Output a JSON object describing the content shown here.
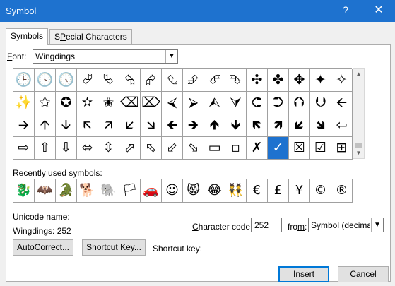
{
  "window": {
    "title": "Symbol",
    "help": "?",
    "close": "✕"
  },
  "tabs": [
    {
      "label_mn": "S",
      "label_rest": "ymbols",
      "active": true
    },
    {
      "label_pre": "",
      "label_mn": "P",
      "label_rest": "ecial Characters",
      "label_s": "S"
    }
  ],
  "font": {
    "label_mn": "F",
    "label_rest": "ont:",
    "value": "Wingdings"
  },
  "symbol_grid": [
    "🕒",
    "🕓",
    "🕔",
    "⮰",
    "⮱",
    "⮲",
    "⮳",
    "⮴",
    "⮵",
    "⮶",
    "⮷",
    "✣",
    "✤",
    "✥",
    "✦",
    "✧",
    "✨",
    "✩",
    "✪",
    "✫",
    "✬",
    "⌫",
    "⌦",
    "⮘",
    "⮚",
    "⮙",
    "⮛",
    "⮈",
    "⮊",
    "⮉",
    "⮋",
    "🡨",
    "🡪",
    "🡩",
    "🡫",
    "🡬",
    "🡭",
    "🡯",
    "🡮",
    "🡸",
    "🡺",
    "🡹",
    "🡻",
    "🡼",
    "🡽",
    "🡿",
    "🡾",
    "⇦",
    "⇨",
    "⇧",
    "⇩",
    "⬄",
    "⇳",
    "⬀",
    "⬁",
    "⬃",
    "⬂",
    "▭",
    "▫",
    "✗",
    "✓",
    "☒",
    "☑",
    "⊞"
  ],
  "selected_index": 60,
  "recent_label": "Recently used symbols:",
  "recent": [
    "🐉",
    "🦇",
    "🐊",
    "🐕",
    "🐘",
    "🏳",
    "🚗",
    "☺",
    "😸",
    "😂",
    "👯",
    "€",
    "£",
    "¥",
    "©",
    "®"
  ],
  "unicode_name_label": "Unicode name:",
  "unicode_value": "Wingdings: 252",
  "char_code": {
    "label_pre": "",
    "label_mn": "C",
    "label_rest": "haracter code:",
    "value": "252"
  },
  "from": {
    "label_pre": "fro",
    "label_mn": "m",
    "label_rest": ":",
    "value": "Symbol (decimal)"
  },
  "buttons": {
    "autocorrect": {
      "pre": "",
      "mn": "A",
      "rest": "utoCorrect..."
    },
    "shortcut_key": {
      "pre": "Shortcut ",
      "mn": "K",
      "rest": "ey..."
    },
    "insert": {
      "pre": "",
      "mn": "I",
      "rest": "nsert"
    },
    "cancel": "Cancel"
  },
  "shortcut_key_label": "Shortcut key:"
}
